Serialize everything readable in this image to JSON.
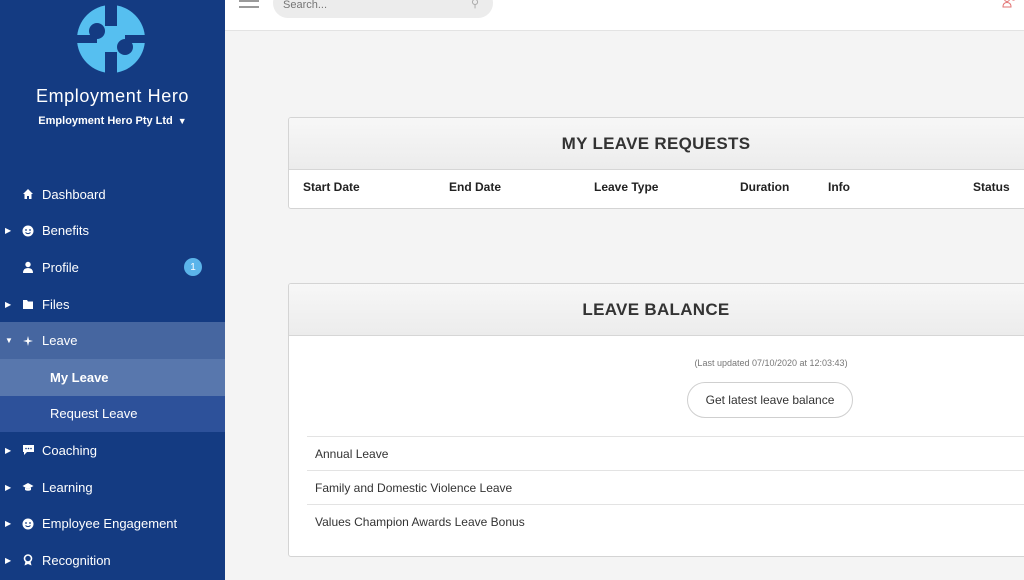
{
  "sidebar": {
    "brand": "Employment Hero",
    "company": "Employment Hero Pty Ltd",
    "items": [
      {
        "label": "Dashboard",
        "icon": "home-icon"
      },
      {
        "label": "Benefits",
        "icon": "smiley-icon"
      },
      {
        "label": "Profile",
        "icon": "person-icon",
        "badge": "1"
      },
      {
        "label": "Files",
        "icon": "folder-icon"
      },
      {
        "label": "Leave",
        "icon": "plane-icon"
      },
      {
        "label": "My Leave"
      },
      {
        "label": "Request Leave"
      },
      {
        "label": "Coaching",
        "icon": "chat-icon"
      },
      {
        "label": "Learning",
        "icon": "graduation-cap-icon"
      },
      {
        "label": "Employee Engagement",
        "icon": "smiley-icon"
      },
      {
        "label": "Recognition",
        "icon": "award-icon"
      }
    ]
  },
  "search": {
    "placeholder": "Search..."
  },
  "requests": {
    "title": "MY LEAVE REQUESTS",
    "columns": [
      "Start Date",
      "End Date",
      "Leave Type",
      "Duration",
      "Info",
      "Status"
    ]
  },
  "balance": {
    "title": "LEAVE BALANCE",
    "updated": "(Last updated 07/10/2020 at 12:03:43)",
    "button": "Get latest leave balance",
    "rows": [
      "Annual Leave",
      "Family and Domestic Violence Leave",
      "Values Champion Awards Leave Bonus"
    ]
  },
  "colors": {
    "sidebar": "#143b82",
    "accent": "#5bb4ea",
    "logo": "#56bff0"
  }
}
